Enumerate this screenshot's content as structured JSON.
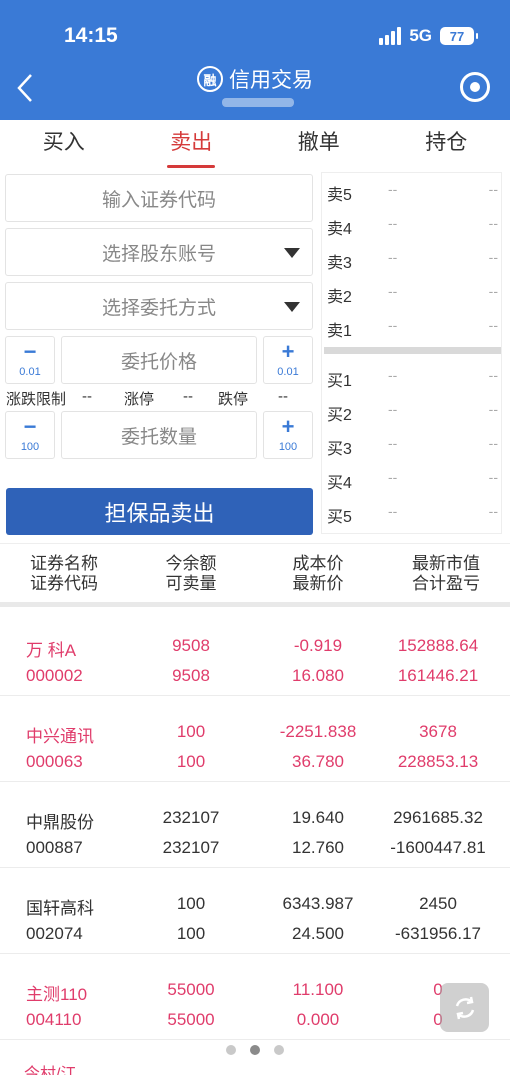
{
  "status": {
    "time": "14:15",
    "network": "5G",
    "battery": "77"
  },
  "nav": {
    "title": "信用交易",
    "rong_glyph": "融"
  },
  "tabs": [
    "买入",
    "卖出",
    "撤单",
    "持仓"
  ],
  "active_tab": "卖出",
  "form": {
    "code_placeholder": "输入证券代码",
    "account_placeholder": "选择股东账号",
    "method_placeholder": "选择委托方式",
    "price_placeholder": "委托价格",
    "price_step_minus": "−",
    "price_step_plus": "+",
    "price_step": "0.01",
    "qty_placeholder": "委托数量",
    "qty_step": "100",
    "limit_label": "涨跌限制",
    "limit_value": "--",
    "up_label": "涨停",
    "up_value": "--",
    "down_label": "跌停",
    "down_value": "--",
    "submit_label": "担保品卖出"
  },
  "order_book": {
    "sell": [
      {
        "label": "卖5",
        "price": "--",
        "volume": "--"
      },
      {
        "label": "卖4",
        "price": "--",
        "volume": "--"
      },
      {
        "label": "卖3",
        "price": "--",
        "volume": "--"
      },
      {
        "label": "卖2",
        "price": "--",
        "volume": "--"
      },
      {
        "label": "卖1",
        "price": "--",
        "volume": "--"
      }
    ],
    "buy": [
      {
        "label": "买1",
        "price": "--",
        "volume": "--"
      },
      {
        "label": "买2",
        "price": "--",
        "volume": "--"
      },
      {
        "label": "买3",
        "price": "--",
        "volume": "--"
      },
      {
        "label": "买4",
        "price": "--",
        "volume": "--"
      },
      {
        "label": "买5",
        "price": "--",
        "volume": "--"
      }
    ]
  },
  "holdings": {
    "headers": [
      [
        "证券名称",
        "证券代码"
      ],
      [
        "今余额",
        "可卖量"
      ],
      [
        "成本价",
        "最新价"
      ],
      [
        "最新市值",
        "合计盈亏"
      ]
    ],
    "rows": [
      {
        "name": "万 科A",
        "code": "000002",
        "balance": "9508",
        "sellable": "9508",
        "cost": "-0.919",
        "last": "16.080",
        "mkt_value": "152888.64",
        "pnl": "161446.21",
        "red": true
      },
      {
        "name": "中兴通讯",
        "code": "000063",
        "balance": "100",
        "sellable": "100",
        "cost": "-2251.838",
        "last": "36.780",
        "mkt_value": "3678",
        "pnl": "228853.13",
        "red": true
      },
      {
        "name": "中鼎股份",
        "code": "000887",
        "balance": "232107",
        "sellable": "232107",
        "cost": "19.640",
        "last": "12.760",
        "mkt_value": "2961685.32",
        "pnl": "-1600447.81",
        "red": false
      },
      {
        "name": "国轩高科",
        "code": "002074",
        "balance": "100",
        "sellable": "100",
        "cost": "6343.987",
        "last": "24.500",
        "mkt_value": "2450",
        "pnl": "-631956.17",
        "red": false
      },
      {
        "name": "主测110",
        "code": "004110",
        "balance": "55000",
        "sellable": "55000",
        "cost": "11.100",
        "last": "0.000",
        "mkt_value": "0",
        "pnl": "0",
        "red": true
      }
    ],
    "partial_next": "今村/江"
  },
  "colors": {
    "nav_blue": "#3a7ad6",
    "button_blue": "#2f62b8",
    "active_red": "#d53a3a",
    "profit_red": "#e03c6b"
  },
  "icons": [
    "back-chevron-icon",
    "rong-badge-icon",
    "target-icon",
    "refresh-icon",
    "signal-icon",
    "battery-icon"
  ]
}
